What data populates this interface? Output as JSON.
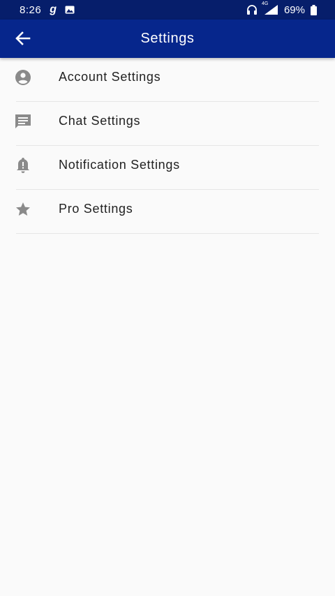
{
  "status_bar": {
    "time": "8:26",
    "carrier_icon_letter": "g",
    "network_label": "4G",
    "battery_percent": "69%",
    "icons": [
      "g-app-icon",
      "image-icon",
      "headphones-icon",
      "signal-icon",
      "battery-icon"
    ]
  },
  "app_bar": {
    "title": "Settings",
    "back_icon": "arrow-back-icon"
  },
  "settings": {
    "items": [
      {
        "label": "Account Settings",
        "icon": "account-circle-icon"
      },
      {
        "label": "Chat Settings",
        "icon": "chat-icon"
      },
      {
        "label": "Notification Settings",
        "icon": "notification-bell-icon"
      },
      {
        "label": "Pro Settings",
        "icon": "star-icon"
      }
    ]
  },
  "colors": {
    "status_bar_bg": "#061e6b",
    "app_bar_bg": "#06268c",
    "page_bg": "#fafafa",
    "icon_gray": "#8a8a8a",
    "text": "#222222"
  }
}
